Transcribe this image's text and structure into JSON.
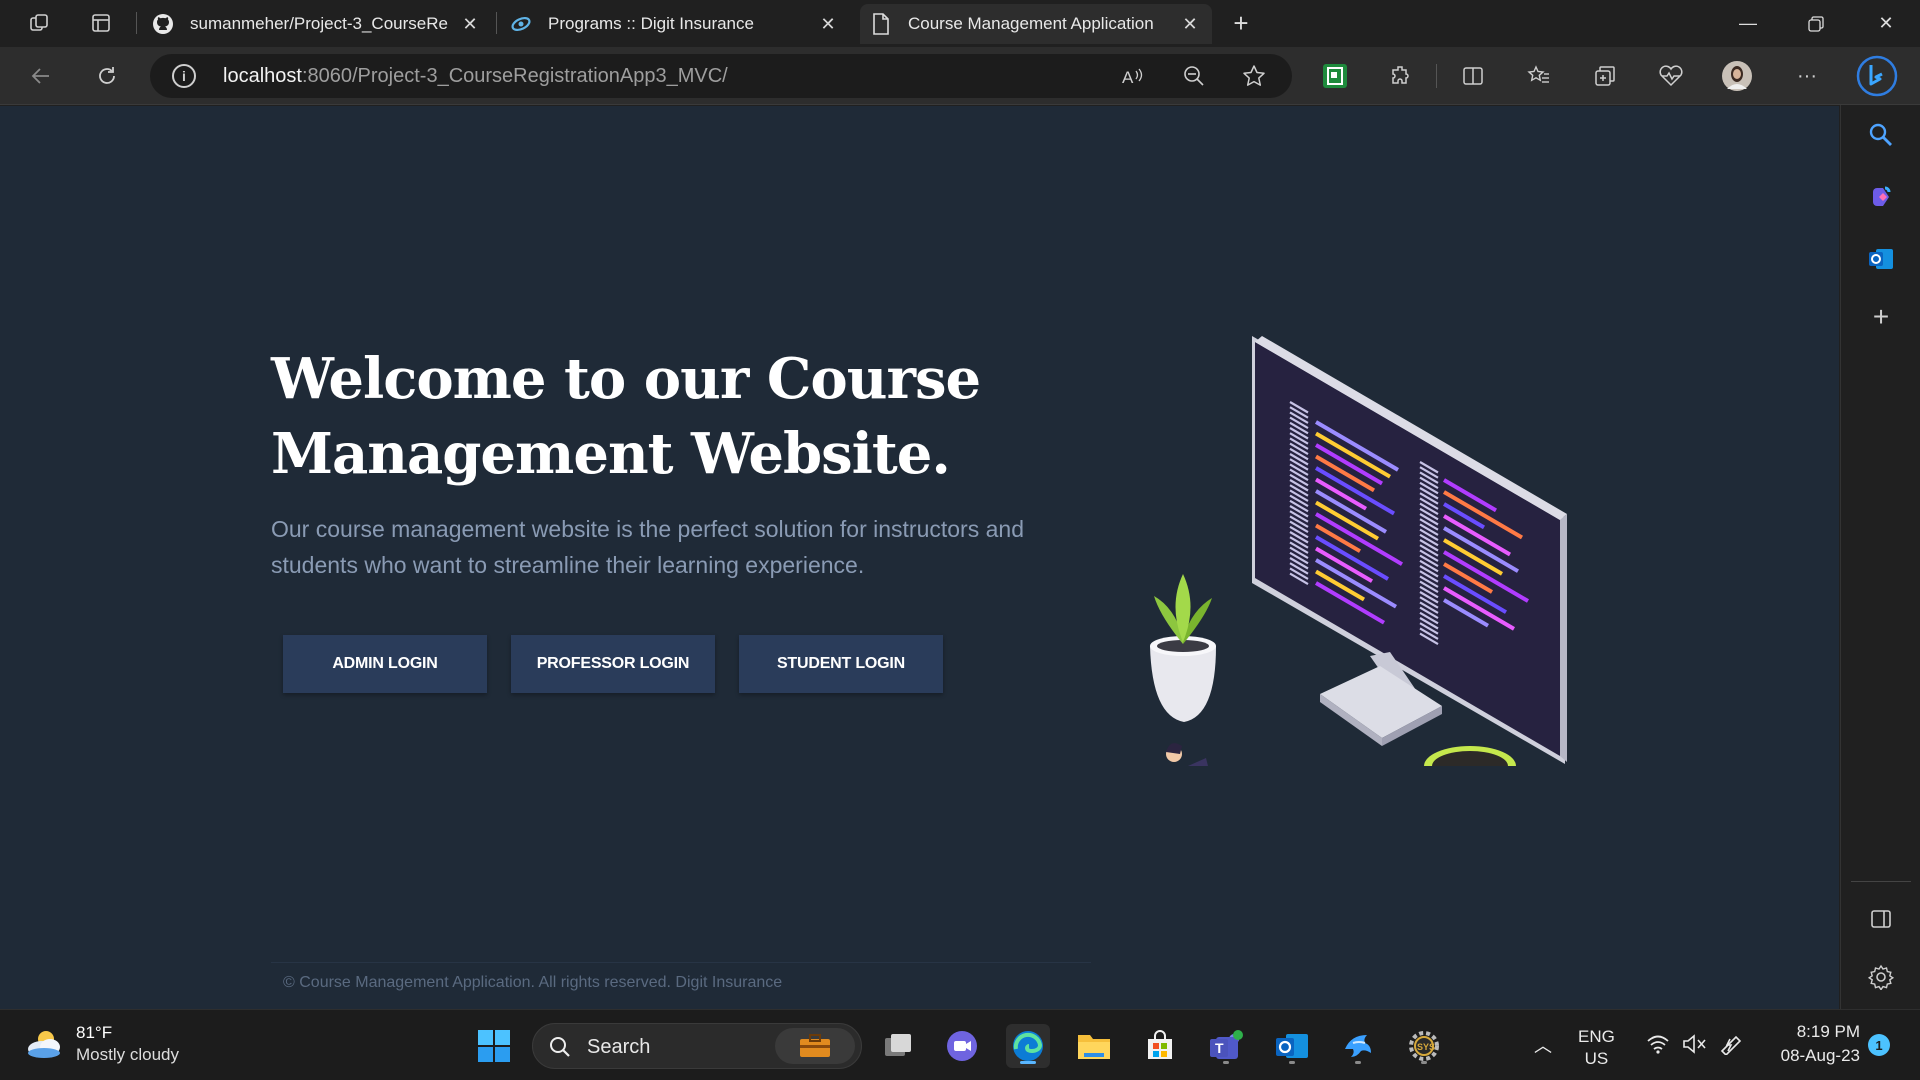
{
  "browser": {
    "tabs": [
      {
        "label": "sumanmeher/Project-3_CourseRe",
        "icon": "github-icon",
        "active": false
      },
      {
        "label": "Programs :: Digit Insurance",
        "icon": "digit-icon",
        "active": false
      },
      {
        "label": "Course Management Application",
        "icon": "page-icon",
        "active": true
      }
    ],
    "address": {
      "host": "localhost",
      "path": ":8060/Project-3_CourseRegistrationApp3_MVC/"
    }
  },
  "hero": {
    "title": "Welcome to our Course Management Website.",
    "subtitle": "Our course management website is the perfect solution for instructors and students who want to streamline their learning experience."
  },
  "buttons": {
    "admin": "ADMIN LOGIN",
    "professor": "PROFESSOR LOGIN",
    "student": "STUDENT LOGIN"
  },
  "footer": {
    "text": "© Course Management Application. All rights reserved. Digit Insurance"
  },
  "taskbar": {
    "weather": {
      "temp": "81°F",
      "condition": "Mostly cloudy"
    },
    "search_label": "Search",
    "lang": {
      "line1": "ENG",
      "line2": "US"
    },
    "clock": {
      "time": "8:19 PM",
      "date": "08-Aug-23"
    },
    "notification_count": "1"
  },
  "colors": {
    "page_bg": "#1f2a37",
    "button_bg": "#2a3c5a",
    "subtitle": "#8a9bb4",
    "monitor": "#2b2747",
    "plant_green": "#8dc63f",
    "mug": "#a8cf2e"
  }
}
